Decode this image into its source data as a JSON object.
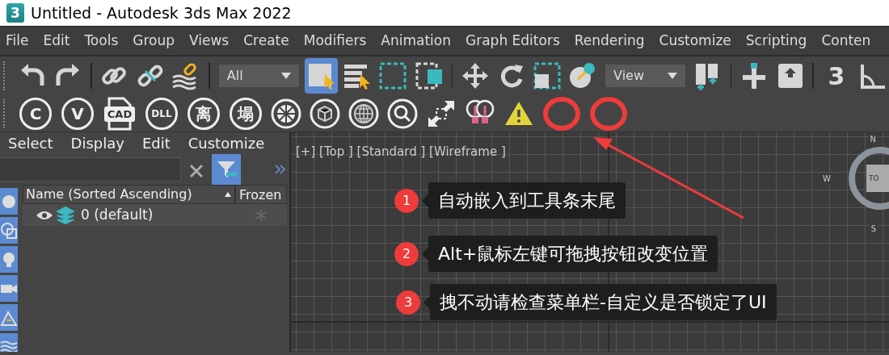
{
  "window": {
    "app_icon_text": "3",
    "title": "Untitled - Autodesk 3ds Max 2022"
  },
  "menu": [
    {
      "label": "File"
    },
    {
      "label": "Edit"
    },
    {
      "label": "Tools"
    },
    {
      "label": "Group"
    },
    {
      "label": "Views"
    },
    {
      "label": "Create"
    },
    {
      "label": "Modifiers"
    },
    {
      "label": "Animation"
    },
    {
      "label": "Graph Editors"
    },
    {
      "label": "Rendering"
    },
    {
      "label": "Customize"
    },
    {
      "label": "Scripting"
    },
    {
      "label": "Conten"
    }
  ],
  "main_toolbar": [
    {
      "kind": "undo",
      "selected": false
    },
    {
      "kind": "redo",
      "selected": false
    },
    {
      "kind": "sep"
    },
    {
      "kind": "link",
      "selected": false
    },
    {
      "kind": "unlink",
      "selected": false
    },
    {
      "kind": "bind",
      "selected": false
    },
    {
      "kind": "sep"
    },
    {
      "kind": "dropdown",
      "value": "All"
    },
    {
      "kind": "select",
      "selected": true
    },
    {
      "kind": "selectname",
      "selected": false
    },
    {
      "kind": "region",
      "selected": false
    },
    {
      "kind": "crossing",
      "selected": false
    },
    {
      "kind": "sep"
    },
    {
      "kind": "move",
      "selected": false
    },
    {
      "kind": "rotate",
      "selected": false
    },
    {
      "kind": "scale",
      "selected": false
    },
    {
      "kind": "place",
      "selected": false
    },
    {
      "kind": "dropdown",
      "value": "View"
    },
    {
      "kind": "pivot",
      "selected": false
    },
    {
      "kind": "sep"
    },
    {
      "kind": "align",
      "selected": false
    },
    {
      "kind": "up",
      "selected": false
    },
    {
      "kind": "sep"
    },
    {
      "kind": "snap",
      "label": "3",
      "selected": false
    },
    {
      "kind": "angle",
      "selected": false
    }
  ],
  "custom_toolbar": [
    {
      "kind": "letter",
      "label": "C"
    },
    {
      "kind": "letter",
      "label": "V"
    },
    {
      "kind": "file",
      "label": "CAD"
    },
    {
      "kind": "small",
      "label": "DLL"
    },
    {
      "kind": "letter",
      "label": "离"
    },
    {
      "kind": "letter",
      "label": "塌"
    },
    {
      "kind": "wheel"
    },
    {
      "kind": "cubes"
    },
    {
      "kind": "globe"
    },
    {
      "kind": "search"
    },
    {
      "kind": "arrows"
    },
    {
      "kind": "bulbs"
    },
    {
      "kind": "warning"
    },
    {
      "kind": "marker"
    },
    {
      "kind": "marker"
    }
  ],
  "explorer": {
    "menu": [
      "Select",
      "Display",
      "Edit",
      "Customize"
    ],
    "filter_selected": true,
    "categories": [
      {
        "kind": "geometry",
        "selected": true
      },
      {
        "kind": "shapes",
        "selected": true
      },
      {
        "kind": "lights",
        "selected": true
      },
      {
        "kind": "cameras",
        "selected": true
      },
      {
        "kind": "helpers",
        "selected": true
      },
      {
        "kind": "spacewarps",
        "selected": true
      }
    ],
    "columns": [
      {
        "label": "Name (Sorted Ascending)",
        "sort_ascending": true
      },
      {
        "label": "Frozen"
      }
    ],
    "rows": [
      {
        "name": "0 (default)",
        "visible": true,
        "frozen": false
      }
    ]
  },
  "viewport": {
    "label": "[+] [Top ] [Standard ] [Wireframe ]",
    "viewcube": {
      "north": "N",
      "west": "W",
      "south": "S",
      "face": "TO"
    },
    "annotations": [
      {
        "number": "1",
        "text": "自动嵌入到工具条末尾"
      },
      {
        "number": "2",
        "text": "Alt+鼠标左键可拖拽按钮改变位置"
      },
      {
        "number": "3",
        "text": "拽不动请检查菜单栏-自定义是否锁定了UI"
      }
    ]
  }
}
